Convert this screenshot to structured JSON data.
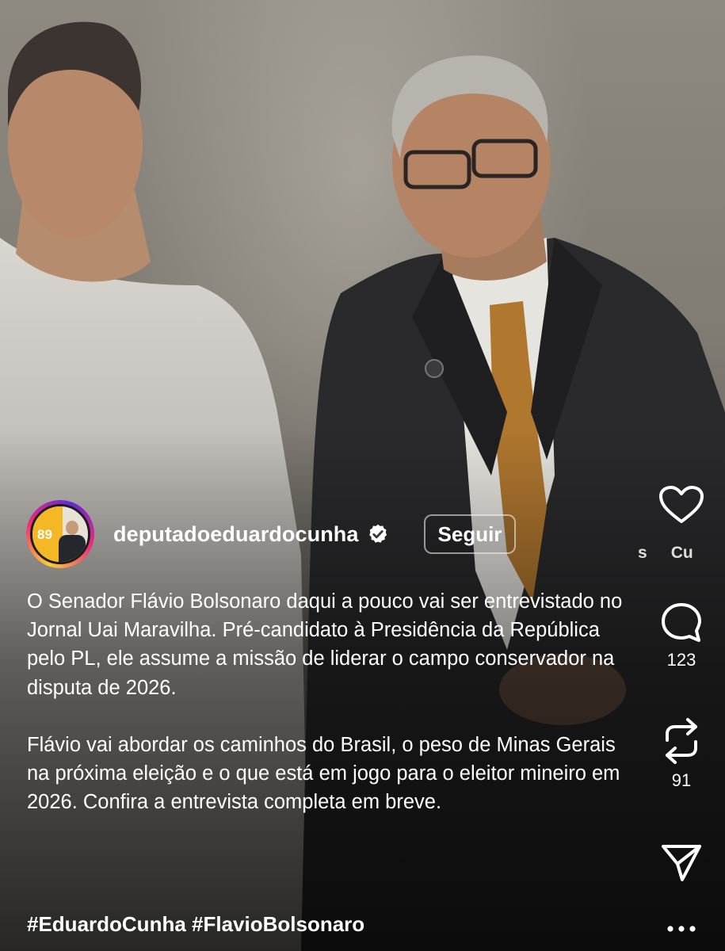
{
  "post": {
    "username": "deputadoeduardocunha",
    "follow_label": "Seguir",
    "avatar_badge": "89",
    "caption_paragraph_1": "O Senador Flávio Bolsonaro daqui a pouco vai ser entrevistado no Jornal Uai Maravilha. Pré-candidato à Presidência da República pelo PL, ele assume a missão de liderar o campo conservador na disputa de 2026.",
    "caption_paragraph_2": "Flávio vai abordar os caminhos do Brasil, o peso de Minas Gerais na próxima eleição e o que está em jogo para o eleitor mineiro em 2026. Confira a entrevista completa em breve.",
    "hashtags": "#EduardoCunha #FlavioBolsonaro"
  },
  "actions": {
    "like_icon": "heart-icon",
    "comment_icon": "comment-icon",
    "comment_count": "123",
    "repost_icon": "repost-icon",
    "repost_count": "91",
    "share_icon": "send-icon",
    "more_icon": "more-icon",
    "audio_text_1": "s",
    "audio_text_2": "Cu"
  },
  "colors": {
    "verified_badge": "#ffffff",
    "ring_gradient_start": "#f9ce34",
    "ring_gradient_mid": "#ee2a7b",
    "ring_gradient_end": "#6228d7"
  }
}
